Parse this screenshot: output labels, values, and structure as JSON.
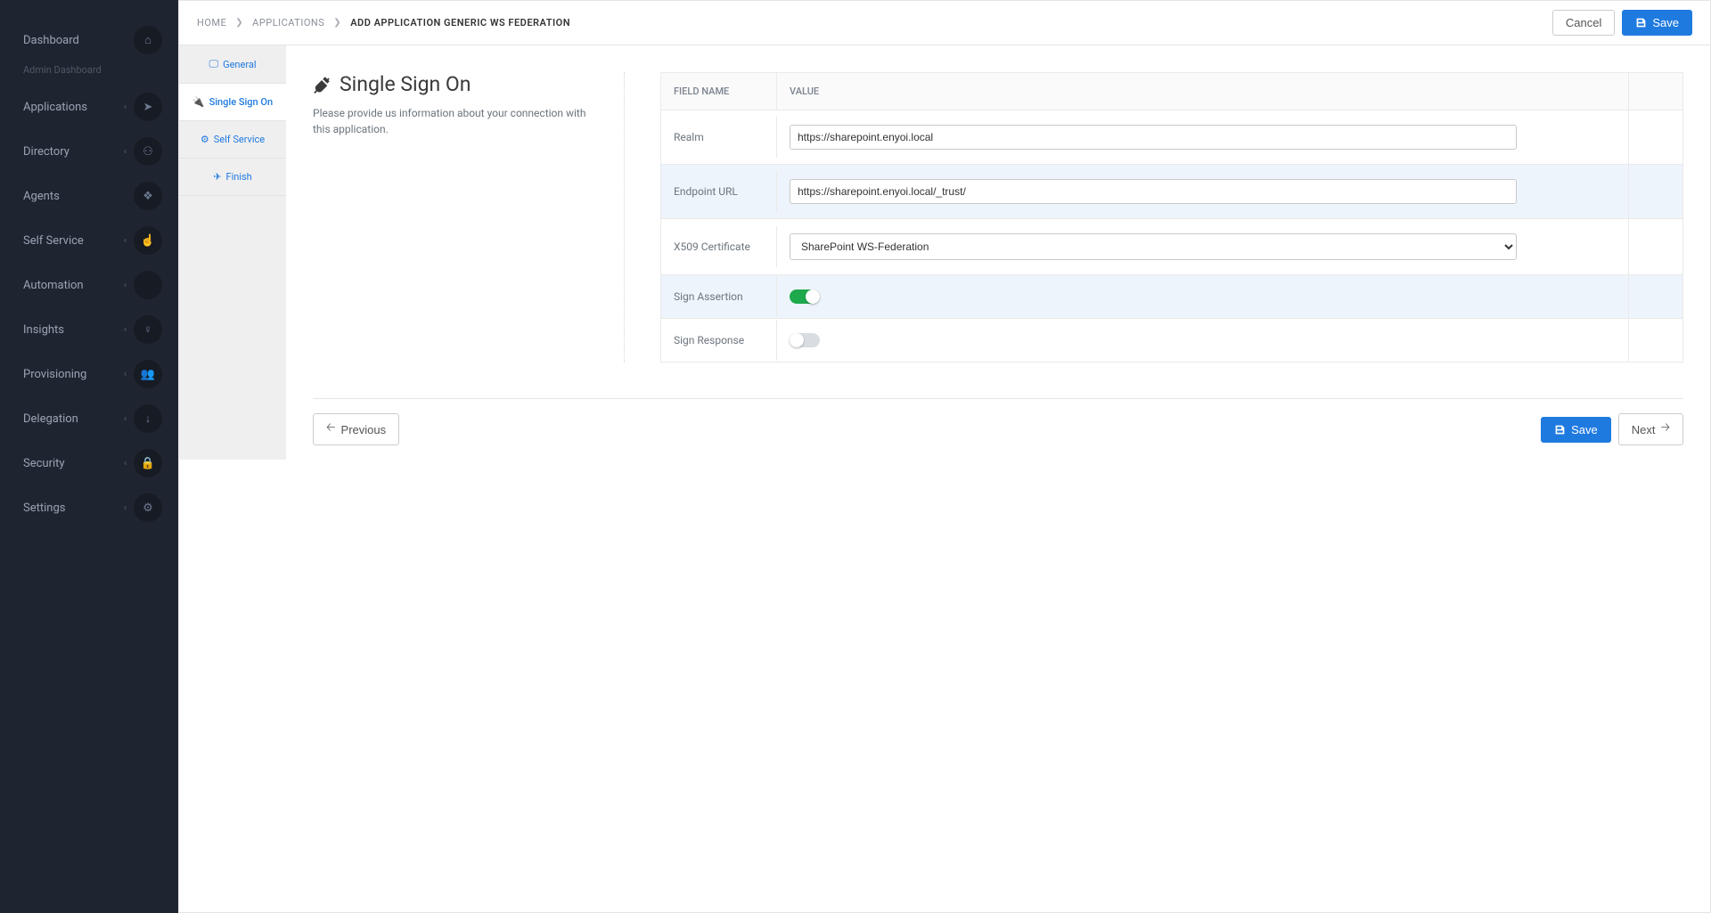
{
  "sidebar": {
    "items": [
      {
        "label": "Dashboard",
        "sub": "Admin Dashboard",
        "icon": "home",
        "chev": false
      },
      {
        "label": "Applications",
        "icon": "location-arrow",
        "chev": true
      },
      {
        "label": "Directory",
        "icon": "sitemap",
        "chev": true
      },
      {
        "label": "Agents",
        "icon": "cubes",
        "chev": false
      },
      {
        "label": "Self Service",
        "icon": "pointer",
        "chev": true
      },
      {
        "label": "Automation",
        "icon": "code",
        "chev": true
      },
      {
        "label": "Insights",
        "icon": "lightbulb",
        "chev": true
      },
      {
        "label": "Provisioning",
        "icon": "users",
        "chev": true
      },
      {
        "label": "Delegation",
        "icon": "arrow-down",
        "chev": true
      },
      {
        "label": "Security",
        "icon": "lock",
        "chev": true
      },
      {
        "label": "Settings",
        "icon": "gear",
        "chev": true
      }
    ]
  },
  "breadcrumb": {
    "items": [
      "HOME",
      "APPLICATIONS",
      "ADD APPLICATION GENERIC WS FEDERATION"
    ]
  },
  "actions": {
    "cancel": "Cancel",
    "save": "Save",
    "previous": "Previous",
    "next": "Next"
  },
  "steps": {
    "tabs": [
      {
        "label": "General",
        "icon": "monitor"
      },
      {
        "label": "Single Sign On",
        "icon": "plug",
        "active": true
      },
      {
        "label": "Self Service",
        "icon": "cogs"
      },
      {
        "label": "Finish",
        "icon": "send"
      }
    ]
  },
  "panel": {
    "title": "Single Sign On",
    "description": "Please provide us information about your connection with this application.",
    "table_headers": {
      "field": "FIELD NAME",
      "value": "VALUE"
    },
    "rows": [
      {
        "label": "Realm",
        "type": "text",
        "value": "https://sharepoint.enyoi.local"
      },
      {
        "label": "Endpoint URL",
        "type": "text",
        "value": "https://sharepoint.enyoi.local/_trust/"
      },
      {
        "label": "X509 Certificate",
        "type": "select",
        "value": "SharePoint WS-Federation"
      },
      {
        "label": "Sign Assertion",
        "type": "toggle",
        "on": true
      },
      {
        "label": "Sign Response",
        "type": "toggle",
        "on": false
      }
    ]
  }
}
